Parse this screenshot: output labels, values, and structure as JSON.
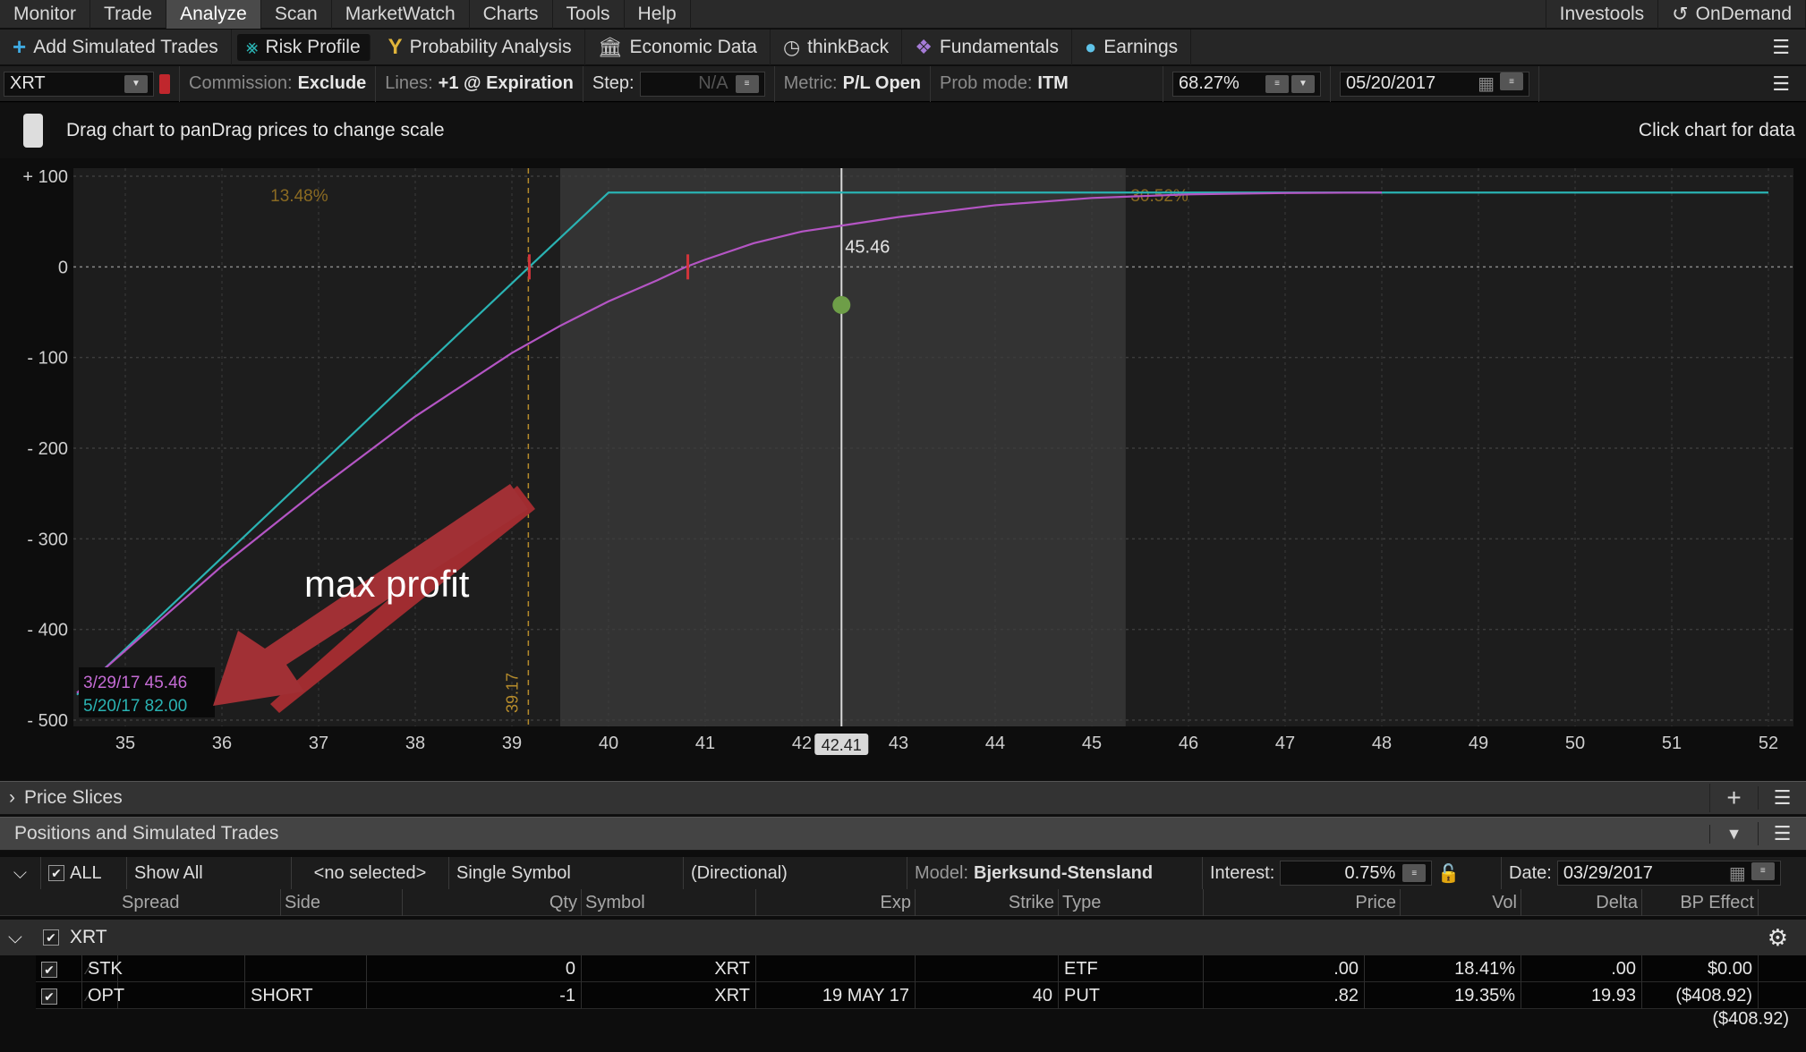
{
  "menu": [
    "Monitor",
    "Trade",
    "Analyze",
    "Scan",
    "MarketWatch",
    "Charts",
    "Tools",
    "Help"
  ],
  "menu_active": "Analyze",
  "menu_right": [
    "Investools",
    "OnDemand"
  ],
  "toolbar": [
    {
      "label": "Add Simulated Trades",
      "icon": "plus-icon"
    },
    {
      "label": "Risk Profile",
      "icon": "risk-profile-icon"
    },
    {
      "label": "Probability Analysis",
      "icon": "probability-icon"
    },
    {
      "label": "Economic Data",
      "icon": "bank-icon"
    },
    {
      "label": "thinkBack",
      "icon": "clock-icon"
    },
    {
      "label": "Fundamentals",
      "icon": "cubes-icon"
    },
    {
      "label": "Earnings",
      "icon": "lightbulb-icon"
    }
  ],
  "params": {
    "symbol": "XRT",
    "commission_label": "Commission:",
    "commission_value": "Exclude",
    "lines_label": "Lines:",
    "lines_value": "+1 @ Expiration",
    "step_label": "Step:",
    "step_value": "N/A",
    "metric_label": "Metric:",
    "metric_value": "P/L Open",
    "probmode_label": "Prob mode:",
    "probmode_value": "ITM",
    "prob_pct": "68.27%",
    "date": "05/20/2017"
  },
  "hint": {
    "left": "Drag chart to panDrag prices to change scale",
    "right": "Click chart for data"
  },
  "chart_data": {
    "type": "line",
    "title": "Risk Profile",
    "xlim": [
      34.5,
      52.2
    ],
    "ylim": [
      -500,
      100
    ],
    "x_ticks": [
      35,
      36,
      37,
      38,
      39,
      40,
      41,
      42,
      43,
      44,
      45,
      46,
      47,
      48,
      49,
      50,
      51,
      52
    ],
    "y_ticks": [
      {
        "v": 100,
        "label": "+ 100"
      },
      {
        "v": 0,
        "label": "0"
      },
      {
        "v": -100,
        "label": "- 100"
      },
      {
        "v": -200,
        "label": "- 200"
      },
      {
        "v": -300,
        "label": "- 300"
      },
      {
        "v": -400,
        "label": "- 400"
      },
      {
        "v": -500,
        "label": "- 500"
      }
    ],
    "series": [
      {
        "name": "5/20/17",
        "label": "5/20/17 82.00",
        "color": "#2ab3b3",
        "x": [
          34.5,
          39.18,
          40.0,
          52.0
        ],
        "y": [
          -472,
          0,
          82,
          82
        ]
      },
      {
        "name": "3/29/17",
        "label": "3/29/17 45.46",
        "color": "#b455c4",
        "x": [
          34.5,
          36.0,
          37.0,
          38.0,
          39.0,
          39.5,
          40.0,
          40.5,
          40.8,
          41.0,
          41.5,
          42.0,
          42.41,
          43.0,
          44.0,
          45.0,
          46.0,
          47.0,
          48.0
        ],
        "y": [
          -470,
          -330,
          -245,
          -165,
          -95,
          -65,
          -38,
          -15,
          0,
          8,
          26,
          39,
          45.46,
          55,
          68,
          76,
          80,
          81.5,
          82
        ]
      }
    ],
    "shaded_range": [
      39.5,
      45.35
    ],
    "prob_labels": [
      {
        "x": 36.8,
        "text": "13.48%"
      },
      {
        "x": 45.7,
        "text": "30.52%"
      }
    ],
    "breakeven": {
      "x": 39.17,
      "label": "39.17"
    },
    "cursor": {
      "x": 42.41,
      "label": "42.41",
      "value_label": "45.46",
      "point_y": -42
    },
    "annotation": "max profit"
  },
  "sections": {
    "price_slices": "Price Slices",
    "positions": "Positions and Simulated Trades"
  },
  "filters": {
    "all": "ALL",
    "show": "Show All",
    "selected": "<no selected>",
    "symbol_mode": "Single Symbol",
    "directional": "(Directional)",
    "model_label": "Model:",
    "model_value": "Bjerksund-Stensland",
    "interest_label": "Interest:",
    "interest_value": "0.75%",
    "date_label": "Date:",
    "date_value": "03/29/2017"
  },
  "columns": [
    "Spread",
    "Side",
    "Qty",
    "Symbol",
    "Exp",
    "Strike",
    "Type",
    "Price",
    "Vol",
    "Delta",
    "BP Effect"
  ],
  "group": "XRT",
  "rows": [
    {
      "spread": "STK",
      "side": "",
      "qty": "0",
      "symbol": "XRT",
      "exp": "",
      "strike": "",
      "type": "ETF",
      "price": ".00",
      "vol": "18.41%",
      "delta": ".00",
      "bp": "$0.00"
    },
    {
      "spread": "OPT",
      "side": "SHORT",
      "qty": "-1",
      "symbol": "XRT",
      "exp": "19 MAY 17",
      "strike": "40",
      "type": "PUT",
      "price": ".82",
      "vol": "19.35%",
      "delta": "19.93",
      "bp": "($408.92)"
    }
  ],
  "total_bp": "($408.92)"
}
